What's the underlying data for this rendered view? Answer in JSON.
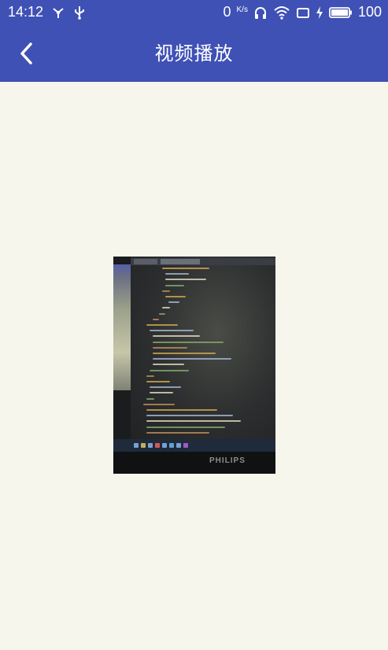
{
  "status_bar": {
    "time": "14:12",
    "net_speed_value": "0",
    "net_speed_unit": "K/s",
    "battery": "100"
  },
  "toolbar": {
    "title": "视频播放",
    "back_icon": "chevron-left-icon"
  },
  "video": {
    "monitor_brand": "PHILIPS"
  },
  "colors": {
    "app_bar": "#3f51b5",
    "background": "#f6f6ec"
  }
}
